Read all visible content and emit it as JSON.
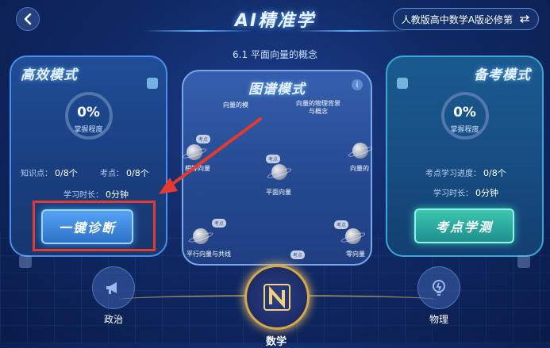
{
  "header": {
    "title": "AI精准学",
    "textbook": "人教版高中数学A版必修第",
    "back_icon": "chevron-left-icon",
    "swap_icon": "swap-icon"
  },
  "subtitle": "6.1 平面向量的概念",
  "left_card": {
    "title": "高效模式",
    "progress_value": "0%",
    "progress_label": "掌握程度",
    "knowledge_label": "知识点：",
    "knowledge_value": "0/8个",
    "exam_label": "考点：",
    "exam_value": "0/8个",
    "time_label": "学习时长：",
    "time_value": "0分钟",
    "button": "一键诊断"
  },
  "center_card": {
    "title": "图谱模式",
    "info_icon": "info-icon",
    "nodes": [
      {
        "text": "向量的模"
      },
      {
        "text": "向量的物理背景\n与概念"
      },
      {
        "text": "平面向量"
      },
      {
        "text": "相等向量"
      },
      {
        "text": "平行向量与共线"
      },
      {
        "text": "零向量"
      },
      {
        "text": "向量的"
      }
    ],
    "tags": [
      "考点",
      "考点",
      "考点",
      "考点",
      "考点"
    ]
  },
  "right_card": {
    "title": "备考模式",
    "progress_value": "0%",
    "progress_label": "掌握程度",
    "exam_progress_label": "考点学习进度：",
    "exam_progress_value": "0/8个",
    "time_label": "学习时长：",
    "time_value": "0分钟",
    "button": "考点学测"
  },
  "subjects": [
    {
      "name": "政治",
      "icon": "megaphone-icon"
    },
    {
      "name": "数学",
      "icon": "math-n-icon"
    },
    {
      "name": "物理",
      "icon": "lightbulb-icon"
    }
  ],
  "colors": {
    "accent_blue": "#4a8df0",
    "accent_teal": "#39a8d8",
    "annotation_red": "#e53a2e",
    "math_gold": "#d6a84a"
  }
}
